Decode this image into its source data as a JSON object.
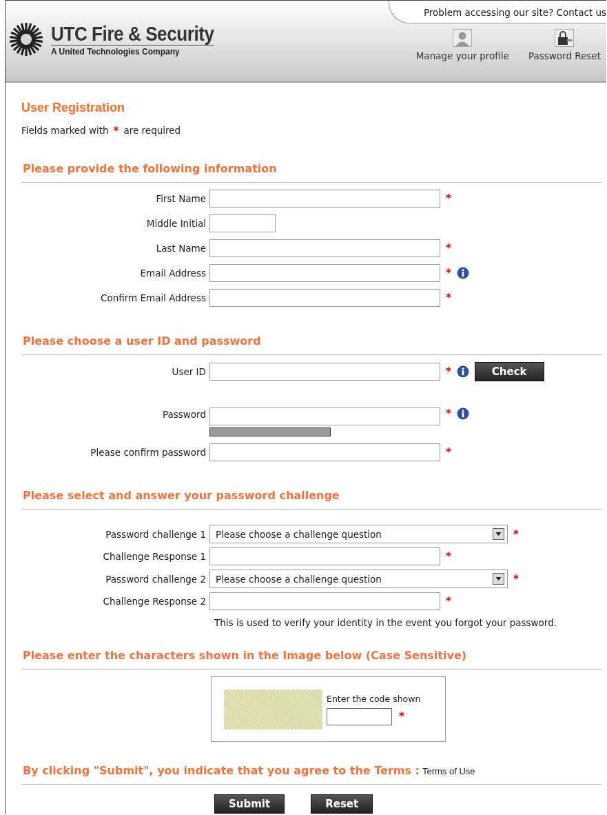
{
  "header": {
    "logo": {
      "name": "UTC Fire & Security",
      "tagline": "A United Technologies Company"
    },
    "contact_link": "Problem accessing our site? Contact us",
    "nav": [
      {
        "label": "Manage your profile",
        "kind": "profile"
      },
      {
        "label": "Password Reset",
        "kind": "lock"
      }
    ]
  },
  "title": "User Registration",
  "required_note": {
    "before": "Fields marked with",
    "mark": "*",
    "after": "are required"
  },
  "sections": [
    {
      "heading": "Please provide the following information",
      "rows": [
        {
          "label": "First Name",
          "kind": "text",
          "required_mark": "*",
          "info": false
        },
        {
          "label": "Middle Initial",
          "kind": "short",
          "info": false
        },
        {
          "label": "Last Name",
          "kind": "text",
          "required_mark": "*",
          "info": false
        },
        {
          "label": "Email Address",
          "kind": "text",
          "required_mark": "*",
          "info": true
        },
        {
          "label": "Confirm Email Address",
          "kind": "text",
          "required_mark": "*",
          "info": false
        }
      ]
    },
    {
      "heading": "Please choose a user ID and password",
      "rows": [
        {
          "label": "User ID",
          "kind": "text",
          "required_mark": "*",
          "info": true,
          "button": "Check"
        },
        {
          "label": "Password",
          "kind": "password",
          "required_mark": "*",
          "info": true
        },
        {
          "label": "Please confirm password",
          "kind": "text",
          "required_mark": "*",
          "info": false
        }
      ]
    },
    {
      "heading": "Please select and answer your password challenge",
      "rows": [
        {
          "label": "Password challenge 1",
          "kind": "select",
          "value": "Please choose a challenge question",
          "required_mark": "*",
          "info": false
        },
        {
          "label": "Challenge Response 1",
          "kind": "text",
          "required_mark": "*",
          "info": false
        },
        {
          "label": "Password challenge 2",
          "kind": "select",
          "value": "Please choose a challenge question",
          "required_mark": "*",
          "info": false
        },
        {
          "label": "Challenge Response 2",
          "kind": "text",
          "required_mark": "*",
          "info": false
        }
      ],
      "note": "This is used to verify your identity in the event you forgot your password."
    }
  ],
  "captcha": {
    "heading": "Please enter the characters shown in the Image below (Case Sensitive)",
    "prompt": "Enter the code shown",
    "required_mark": "*"
  },
  "terms": {
    "text": "By clicking \"Submit\", you indicate that you agree to the Terms :",
    "link": "Terms of Use"
  },
  "buttons": [
    "Submit",
    "Reset"
  ]
}
